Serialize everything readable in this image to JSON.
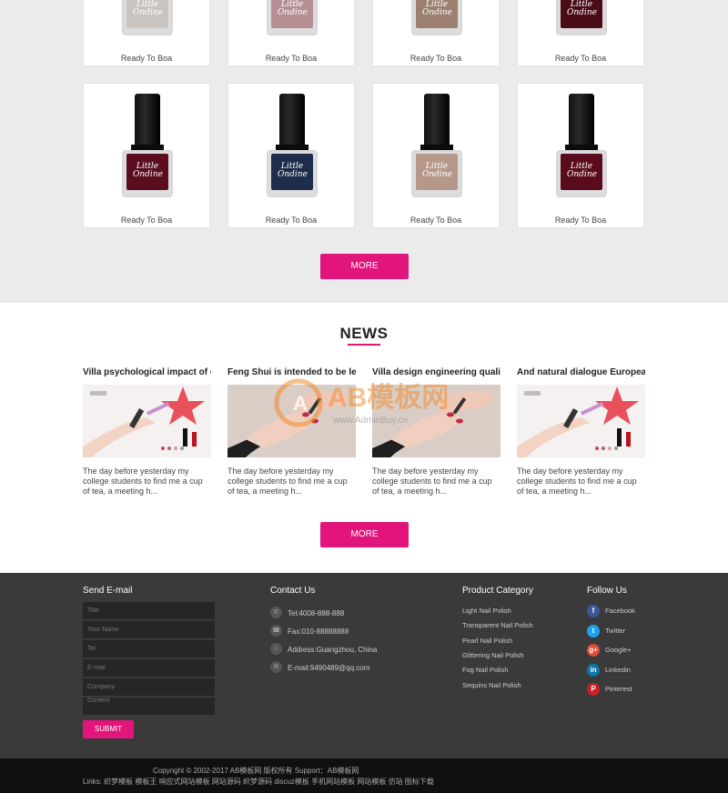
{
  "products": [
    {
      "caption": "Ready To Boa",
      "color": "#c9c4c0"
    },
    {
      "caption": "Ready To Boa",
      "color": "#b68f95"
    },
    {
      "caption": "Ready To Boa",
      "color": "#9c7f6e"
    },
    {
      "caption": "Ready To Boa",
      "color": "#4a0d18"
    },
    {
      "caption": "Ready To Boa",
      "color": "#5a0d1e"
    },
    {
      "caption": "Ready To Boa",
      "color": "#1f2d4c"
    },
    {
      "caption": "Ready To Boa",
      "color": "#b6988a"
    },
    {
      "caption": "Ready To Boa",
      "color": "#5a0c1c"
    }
  ],
  "bottle_label": "Little Ondine",
  "more_label": "MORE",
  "news": {
    "title": "NEWS",
    "items": [
      {
        "title": "Villa psychological impact of c",
        "excerpt": "The day before yesterday my college students to find me a cup of tea, a meeting h...",
        "image": "cosmetics-ad"
      },
      {
        "title": "Feng Shui is intended to be lei",
        "excerpt": "The day before yesterday my college students to find me a cup of tea, a meeting h...",
        "image": "manicure-hands"
      },
      {
        "title": "Villa design engineering qualit",
        "excerpt": "The day before yesterday my college students to find me a cup of tea, a meeting h...",
        "image": "manicure-hands"
      },
      {
        "title": "And natural dialogue European",
        "excerpt": "The day before yesterday my college students to find me a cup of tea, a meeting h...",
        "image": "cosmetics-ad"
      }
    ]
  },
  "watermark": {
    "brand": "AB模板网",
    "url": "www.AdminBuy.cn"
  },
  "footer": {
    "send_email": {
      "title": "Send E-mail",
      "fields": [
        "Title",
        "Your Name",
        "Tel",
        "E-mail",
        "Company",
        "Content"
      ],
      "submit": "SUBMIT"
    },
    "contact": {
      "title": "Contact Us",
      "rows": [
        {
          "icon": "phone-icon",
          "text": "Tel:4008-888-888"
        },
        {
          "icon": "fax-icon",
          "text": "Fax:010-88888888"
        },
        {
          "icon": "location-icon",
          "text": "Address:Guangzhou, China"
        },
        {
          "icon": "mail-icon",
          "text": "E-mail:9490489@qq.com"
        }
      ]
    },
    "categories": {
      "title": "Product Category",
      "items": [
        "Light Nail Polish",
        "Transparent Nail Polish",
        "Pearl Nail Polish",
        "Glittering Nail Polish",
        "Fog Nail Polish",
        "Sequins Nail Polish"
      ]
    },
    "follow": {
      "title": "Follow Us",
      "items": [
        {
          "label": "Facebook",
          "glyph": "f",
          "color": "#3b5998"
        },
        {
          "label": "Twitter",
          "glyph": "t",
          "color": "#1da1f2"
        },
        {
          "label": "Google+",
          "glyph": "g+",
          "color": "#dd4b39"
        },
        {
          "label": "Linkedin",
          "glyph": "in",
          "color": "#0e76a8"
        },
        {
          "label": "Pinterest",
          "glyph": "P",
          "color": "#cb2027"
        }
      ]
    }
  },
  "copyright": {
    "line1": "Copyright © 2002-2017 AB模板网 版权所有  Support：AB模板网",
    "line2": "Links: 织梦模板 模板王 响应式网站模板 网站源码 织梦源码 discuz模板 手机网站模板 网站模板 仿站 图标下载"
  }
}
